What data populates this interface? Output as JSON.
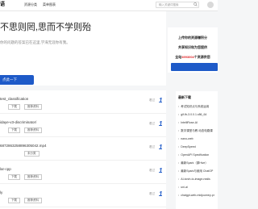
{
  "header": {
    "logo": "语",
    "nav": [
      "资源分类",
      "菜单图表"
    ],
    "search_placeholder": "输入关键词搜索"
  },
  "hero": {
    "title": "不思则罔,思而不学则殆",
    "subtitle": "你的问题的答案已在这里,学海无涯你有我。",
    "button": "点此一下"
  },
  "promo": {
    "line1": "上传你的资源赚积分",
    "line2": "共享知识和为您提供",
    "line3_prefix": "全站",
    "line3_highlight": "4993004",
    "line3_suffix": "个资源供您"
  },
  "list": [
    {
      "title": "test_classification",
      "tags": [
        "下载",
        "推荐资料"
      ],
      "rank": "看过",
      "num": "1"
    },
    {
      "title": "idaye-v3-discriminator/",
      "tags": [
        "下载",
        "推荐资料"
      ],
      "rank": "看过",
      "num": "1"
    },
    {
      "title": "6872863258896305042.mp4",
      "tags": [
        "未分类"
      ],
      "rank": "看过",
      "num": "1"
    },
    {
      "title": "lar-cpp",
      "tags": [
        "下载",
        "推荐资料"
      ],
      "rank": "看过",
      "num": "1"
    },
    {
      "title": "ly",
      "tags": [
        "下载",
        "推荐资料"
      ],
      "rank": "看过",
      "num": "1"
    }
  ],
  "sidebar": {
    "title": "最新下载",
    "items": [
      "考试知识点与系统运用",
      "gif-fb-3.0.0.1.x86_64",
      "IntelliRose-AI",
      "数字课堂与教 动态电路课",
      "nano-web",
      "DeepSpeed",
      "OpenAPI Specification",
      "最新Spark（原Hive）",
      "最新Spark与使用 ChatGP",
      "AI-torch-to-image-realis",
      "uni-ai",
      "chatgpt-web-midjourney-pr"
    ]
  }
}
